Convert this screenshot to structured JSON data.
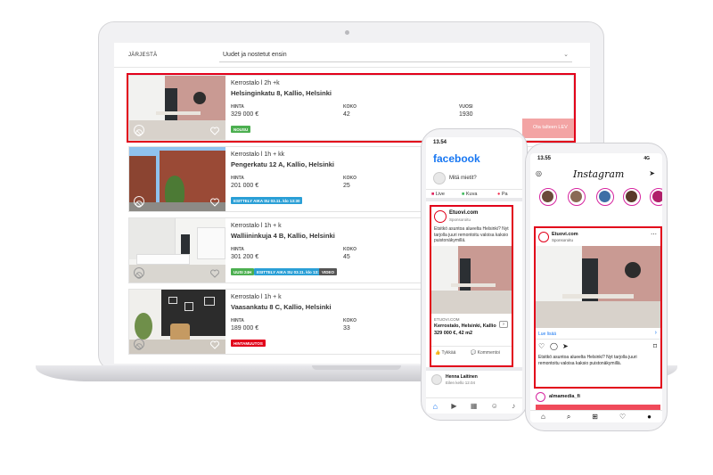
{
  "laptop": {
    "sort_label": "JÄRJESTÄ",
    "sort_value": "Uudet ja nostetut ensin",
    "cta_label": "Ota talteen LEV",
    "listings": [
      {
        "title": "Kerrostalo l 2h +k",
        "address": "Helsinginkatu 8, Kallio, Helsinki",
        "col1_label": "HINTA",
        "col1_value": "329 000 €",
        "col2_label": "KOKO",
        "col2_value": "42",
        "col3_label": "VUOSI",
        "col3_value": "1930",
        "badges": [
          {
            "text": "NOUSU",
            "color": "#4caf50"
          }
        ]
      },
      {
        "title": "Kerrostalo l 1h + kk",
        "address": "Pengerkatu 12 A, Kallio, Helsinki",
        "col1_label": "HINTA",
        "col1_value": "201 000 €",
        "col2_label": "KOKO",
        "col2_value": "25",
        "badges": [
          {
            "text": "ESITTELY AIKA SU 03.11. klo 13:30",
            "color": "#2a9fd6"
          }
        ]
      },
      {
        "title": "Kerrostalo l 1h + k",
        "address": "Walliininkuja 4 B, Kallio, Helsinki",
        "col1_label": "HINTA",
        "col1_value": "301 200 €",
        "col2_label": "KOKO",
        "col2_value": "45",
        "badges": [
          {
            "text": "UUSI 24H",
            "color": "#4caf50"
          },
          {
            "text": "ESITTELY AIKA SU 03.11. klo 13:30",
            "color": "#2a9fd6"
          },
          {
            "text": "VIDEO",
            "color": "#555555"
          }
        ]
      },
      {
        "title": "Kerrostalo l 1h + k",
        "address": "Vaasankatu 8 C, Kallio, Helsinki",
        "col1_label": "HINTA",
        "col1_value": "189 000 €",
        "col2_label": "KOKO",
        "col2_value": "33",
        "badges": [
          {
            "text": "HINTAMUUTOS",
            "color": "#e2001a"
          }
        ]
      }
    ]
  },
  "facebook": {
    "time": "13.54",
    "logo": "facebook",
    "prompt": "Mitä mietit?",
    "tabs": [
      "Live",
      "Kuva",
      "Pa"
    ],
    "advertiser": "Etuovi.com",
    "sponsored": "Sponsoroitu",
    "body": "Etsitkö asuntoa alueelta Helsinki? Nyt tarjolla juuri remontoitu valoisa kaksio puistonäkymillä.",
    "domain": "ETUOVI.COM",
    "headline": "Kerrostalo, Helsinki, Kallio",
    "price_line": "329 000 €, 42 m2",
    "like": "Tykkää",
    "comment": "Kommentoi",
    "next_user": "Henna Laitinen",
    "next_meta": "Eilen kello 12.04"
  },
  "instagram": {
    "time": "13.55",
    "network": "4G",
    "logo": "Instagram",
    "advertiser": "Etuovi.com",
    "sponsored": "Sponsoroitu",
    "cta": "Lue lisää",
    "caption": "Etsitkö asuntoa alueelta Helsinki? Nyt tarjolla juuri remontoitu valoisa kaksio puistonäkymillä.",
    "next_user": "almamedia_fi"
  },
  "colors": {
    "highlight": "#e2001a",
    "facebook_blue": "#1877f2"
  }
}
